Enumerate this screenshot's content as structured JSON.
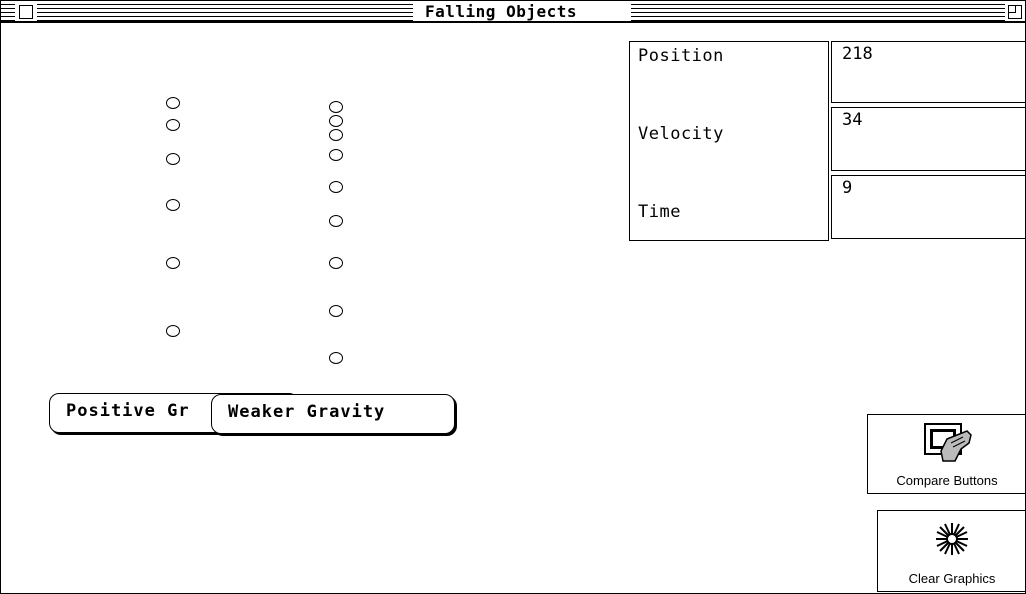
{
  "window": {
    "title": "Falling Objects"
  },
  "readouts": {
    "position_label": "Position",
    "velocity_label": "Velocity",
    "time_label": "Time",
    "position_value": "218",
    "velocity_value": "34",
    "time_value": "9"
  },
  "buttons": {
    "positive_gravity": "Positive Gr",
    "weaker_gravity": "Weaker Gravity",
    "compare_buttons": "Compare Buttons",
    "clear_graphics": "Clear Graphics"
  },
  "icons": {
    "close": "close-box-icon",
    "zoom": "zoom-box-icon",
    "compare": "hand-pressing-button-icon",
    "clear": "starburst-icon"
  }
}
